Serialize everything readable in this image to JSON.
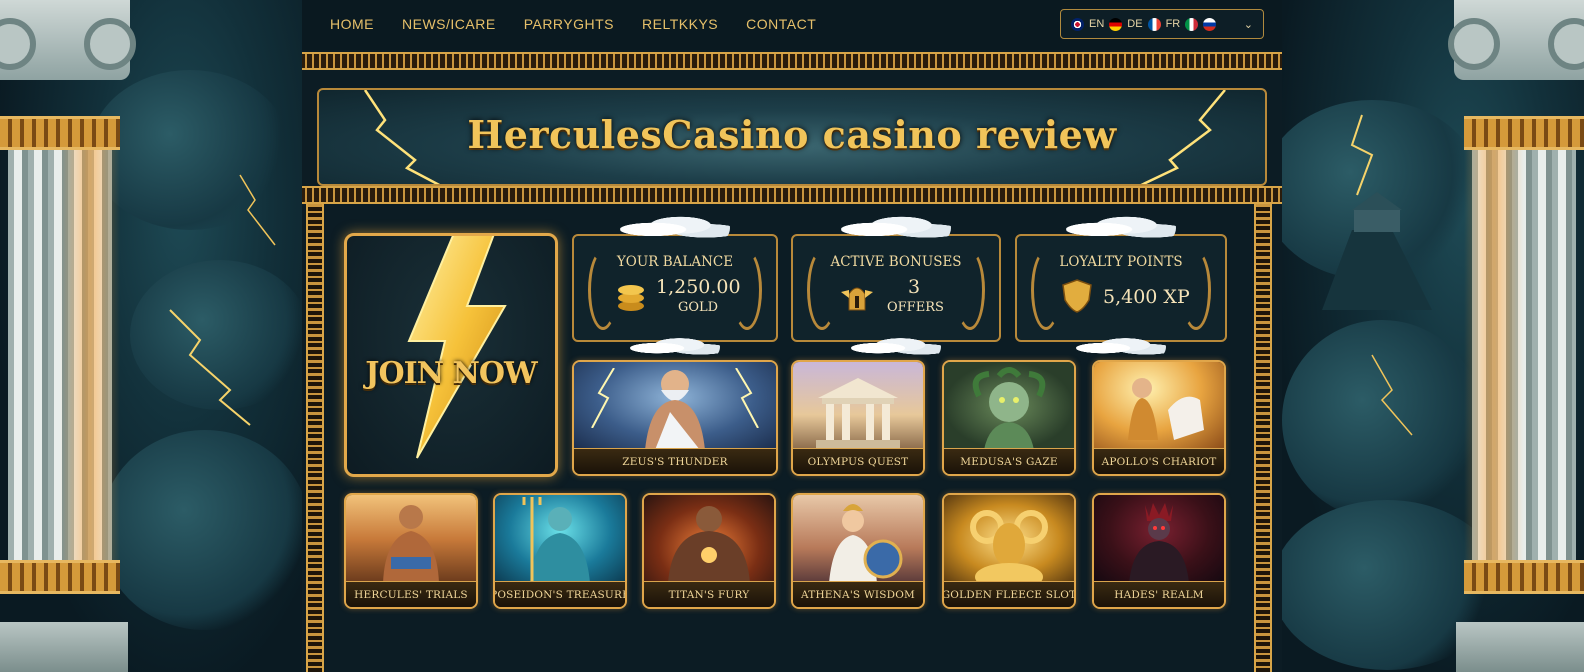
{
  "nav": {
    "links": [
      "HOME",
      "NEWS/ICARE",
      "PARRYGHTS",
      "RELTKKYS",
      "CONTACT"
    ],
    "languages": [
      "EN",
      "DE",
      "FR"
    ],
    "flag_icons": [
      "uk-flag-icon",
      "germany-flag-icon",
      "france-flag-icon",
      "italy-flag-icon",
      "russia-flag-icon"
    ]
  },
  "hero": {
    "title": "HerculesCasino casino review"
  },
  "join": {
    "label": "JOIN NOW",
    "icon": "lightning-bolt-icon"
  },
  "stats": [
    {
      "label": "YOUR BALANCE",
      "value": "1,250.00",
      "unit": "GOLD",
      "icon": "gold-coins-icon"
    },
    {
      "label": "ACTIVE BONUSES",
      "value": "3",
      "unit": "OFFERS",
      "icon": "winged-helmet-icon"
    },
    {
      "label": "LOYALTY POINTS",
      "value": "5,400 XP",
      "unit": "",
      "icon": "shield-icon"
    }
  ],
  "games": [
    {
      "title": "ZEUS'S THUNDER"
    },
    {
      "title": "OLYMPUS QUEST"
    },
    {
      "title": "MEDUSA'S GAZE"
    },
    {
      "title": "APOLLO'S CHARIOT"
    },
    {
      "title": "HERCULES' TRIALS"
    },
    {
      "title": "POSEIDON'S TREASURE"
    },
    {
      "title": "TITAN'S FURY"
    },
    {
      "title": "ATHENA'S WISDOM"
    },
    {
      "title": "GOLDEN FLEECE SLOT"
    },
    {
      "title": "HADES' REALM"
    }
  ],
  "colors": {
    "gold": "#e6c06a",
    "panel": "#0c1c24",
    "border": "#b8893a"
  }
}
